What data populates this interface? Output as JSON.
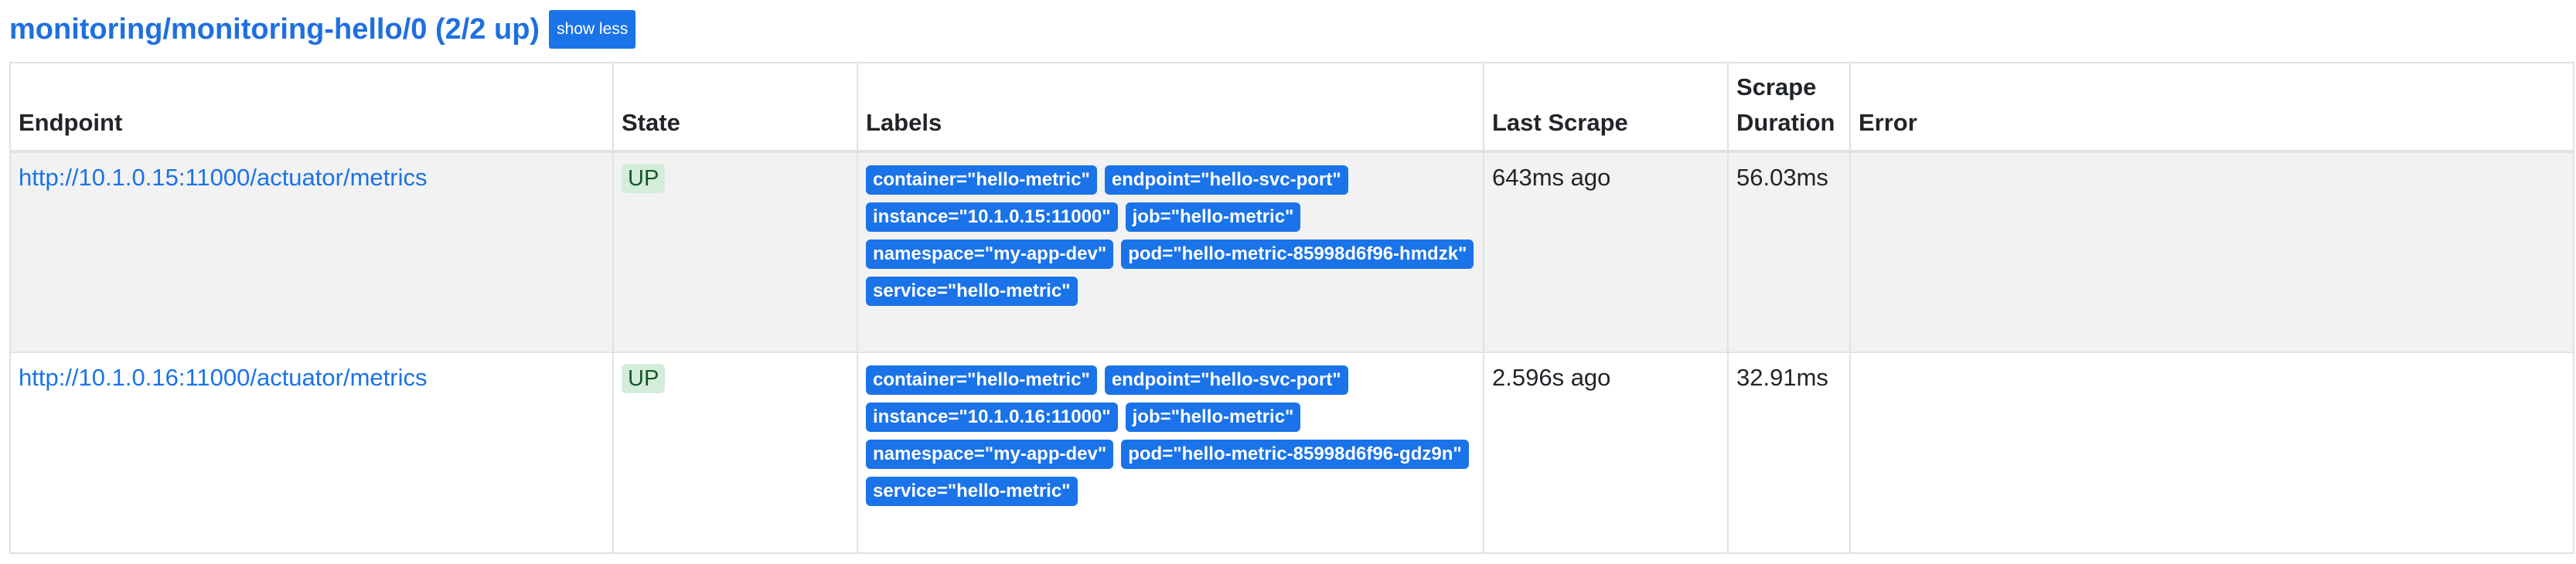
{
  "header": {
    "title": "monitoring/monitoring-hello/0 (2/2 up)",
    "toggle_button": "show less"
  },
  "table": {
    "headers": {
      "endpoint": "Endpoint",
      "state": "State",
      "labels": "Labels",
      "last_scrape": "Last Scrape",
      "scrape_duration": "Scrape Duration",
      "error": "Error"
    },
    "rows": [
      {
        "endpoint": "http://10.1.0.15:11000/actuator/metrics",
        "state": "UP",
        "labels": [
          "container=\"hello-metric\"",
          "endpoint=\"hello-svc-port\"",
          "instance=\"10.1.0.15:11000\"",
          "job=\"hello-metric\"",
          "namespace=\"my-app-dev\"",
          "pod=\"hello-metric-85998d6f96-hmdzk\"",
          "service=\"hello-metric\""
        ],
        "last_scrape": "643ms ago",
        "scrape_duration": "56.03ms",
        "error": ""
      },
      {
        "endpoint": "http://10.1.0.16:11000/actuator/metrics",
        "state": "UP",
        "labels": [
          "container=\"hello-metric\"",
          "endpoint=\"hello-svc-port\"",
          "instance=\"10.1.0.16:11000\"",
          "job=\"hello-metric\"",
          "namespace=\"my-app-dev\"",
          "pod=\"hello-metric-85998d6f96-gdz9n\"",
          "service=\"hello-metric\""
        ],
        "last_scrape": "2.596s ago",
        "scrape_duration": "32.91ms",
        "error": ""
      }
    ]
  },
  "colors": {
    "link": "#1a73e8",
    "label_badge": "#1a73e8",
    "state_up_bg": "#d4edda",
    "state_up_text": "#155724",
    "row_stripe": "#f2f2f2"
  }
}
